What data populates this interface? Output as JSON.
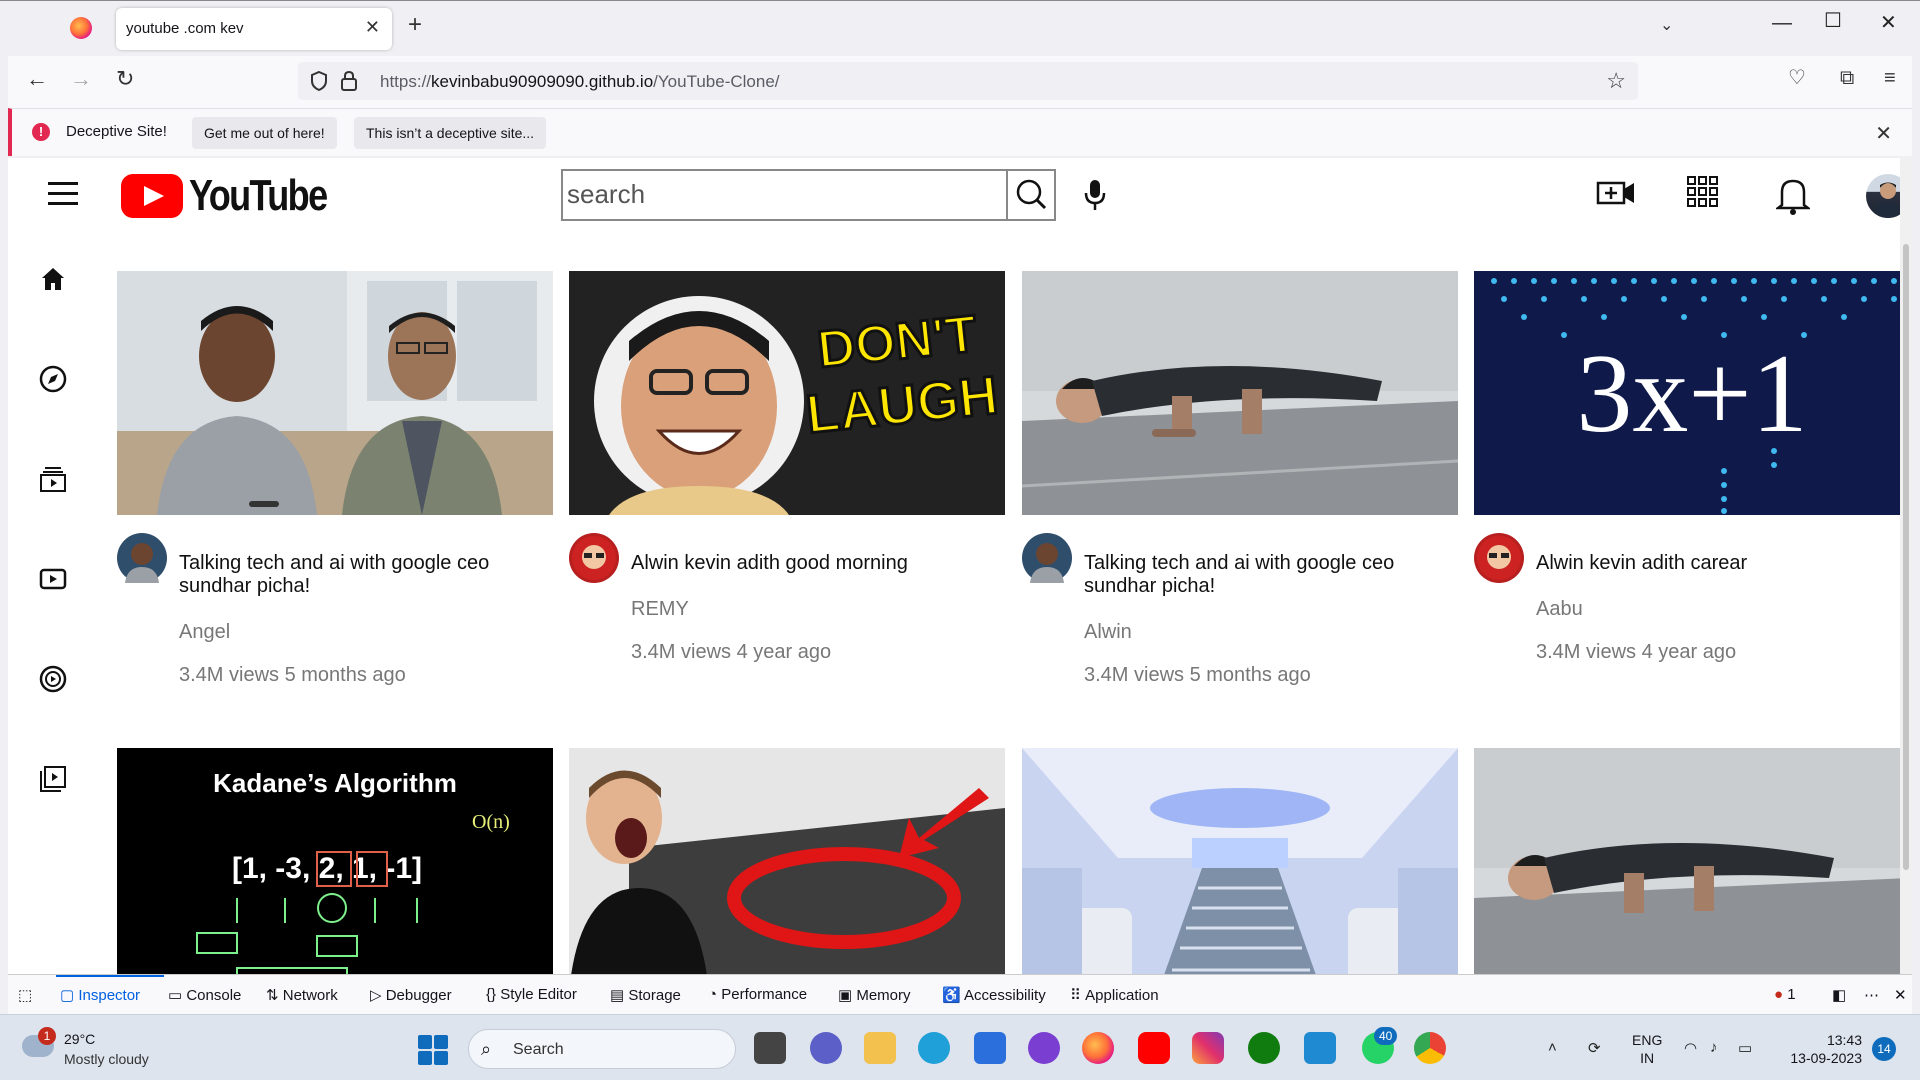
{
  "browser": {
    "tab_title": "youtube .com kev",
    "url_prefix": "https://",
    "url_domain": "kevinbabu90909090.github.io",
    "url_path": "/YouTube-Clone/"
  },
  "notification": {
    "text": "Deceptive Site!",
    "btn_leave": "Get me out of here!",
    "btn_ignore": "This isn’t a deceptive site..."
  },
  "youtube": {
    "logo_text": "YouTube",
    "search_value": "search",
    "videos": [
      {
        "title": "Talking tech and ai with google ceo sundhar picha!",
        "channel": "Angel",
        "meta": "3.4M views 5 months ago"
      },
      {
        "title": "Alwin kevin adith good morning",
        "channel": "REMY",
        "meta": "3.4M views 4 year ago"
      },
      {
        "title": "Talking tech and ai with google ceo sundhar picha!",
        "channel": "Alwin",
        "meta": "3.4M views 5 months ago"
      },
      {
        "title": "Alwin kevin adith carear",
        "channel": "Aabu",
        "meta": "3.4M views 4 year ago"
      }
    ],
    "thumb_text": {
      "dont_laugh_1": "DON'T",
      "dont_laugh_2": "LAUGH",
      "collatz": "3x+1",
      "kadane_title": "Kadane’s Algorithm",
      "kadane_array": "[1, -3, 2, 1, -1]",
      "kadane_note": "O(n)"
    }
  },
  "devtools": {
    "tabs": [
      "Inspector",
      "Console",
      "Network",
      "Debugger",
      "Style Editor",
      "Storage",
      "Performance",
      "Memory",
      "Accessibility",
      "Application"
    ],
    "error_count": "1"
  },
  "taskbar": {
    "weather_temp": "29°C",
    "weather_desc": "Mostly cloudy",
    "weather_badge": "1",
    "search_placeholder": "Search",
    "whatsapp_badge": "40",
    "lang_1": "ENG",
    "lang_2": "IN",
    "time": "13:43",
    "date": "13-09-2023",
    "notification_count": "14"
  }
}
